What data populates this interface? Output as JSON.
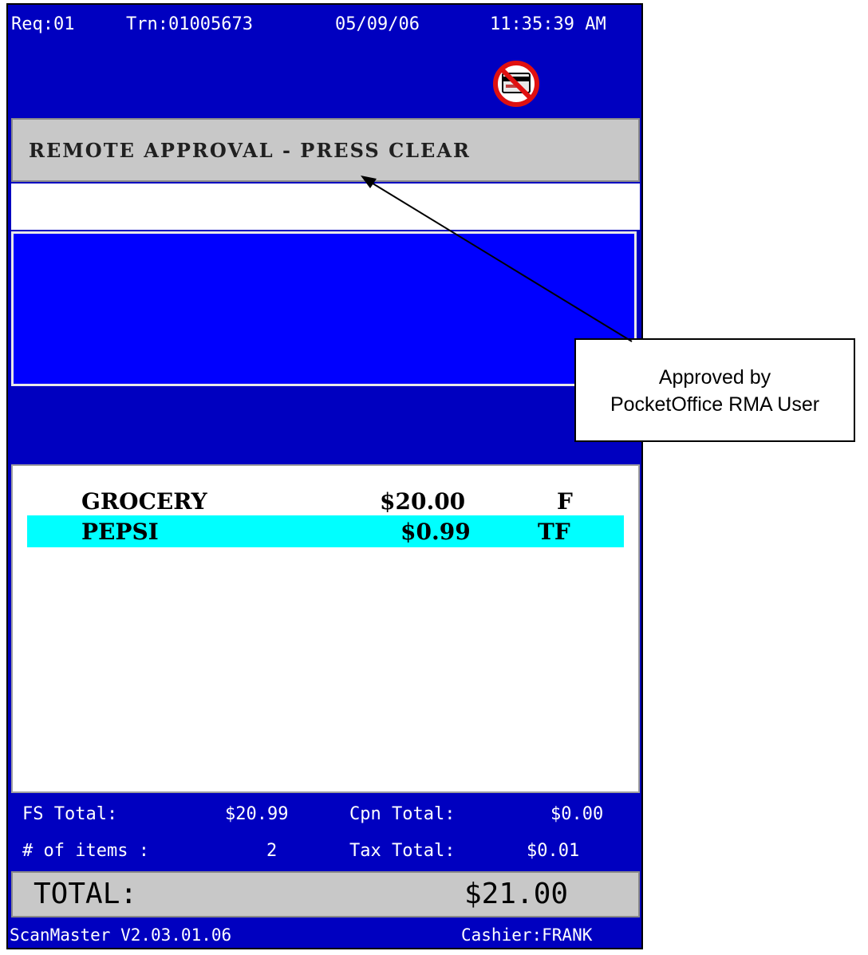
{
  "header": {
    "register": "Req:01",
    "transaction": "Trn:01005673",
    "date": "05/09/06",
    "time": "11:35:39 AM",
    "status_icon": "no-credit-card-icon"
  },
  "message": "REMOTE APPROVAL - PRESS CLEAR",
  "input_value": "",
  "items": [
    {
      "name": "GROCERY",
      "price": "$20.00",
      "flags": "F",
      "selected": false
    },
    {
      "name": "PEPSI",
      "price": "$0.99",
      "flags": "TF",
      "selected": true
    }
  ],
  "totals": {
    "fs_label": "FS Total:",
    "fs_value": "$20.99",
    "cpn_label": "Cpn Total:",
    "cpn_value": "$0.00",
    "items_label": "# of items :",
    "items_value": "2",
    "tax_label": "Tax Total:",
    "tax_value": "$0.01"
  },
  "grand_total": {
    "label": "TOTAL:",
    "value": "$21.00"
  },
  "footer": {
    "version": "ScanMaster V2.03.01.06",
    "cashier": "Cashier:FRANK"
  },
  "callout": {
    "line1": "Approved by",
    "line2": "PocketOffice RMA User"
  },
  "colors": {
    "screen_blue": "#0000c0",
    "panel_blue": "#0000ff",
    "highlight": "#00ffff",
    "gray": "#c8c8c8"
  }
}
